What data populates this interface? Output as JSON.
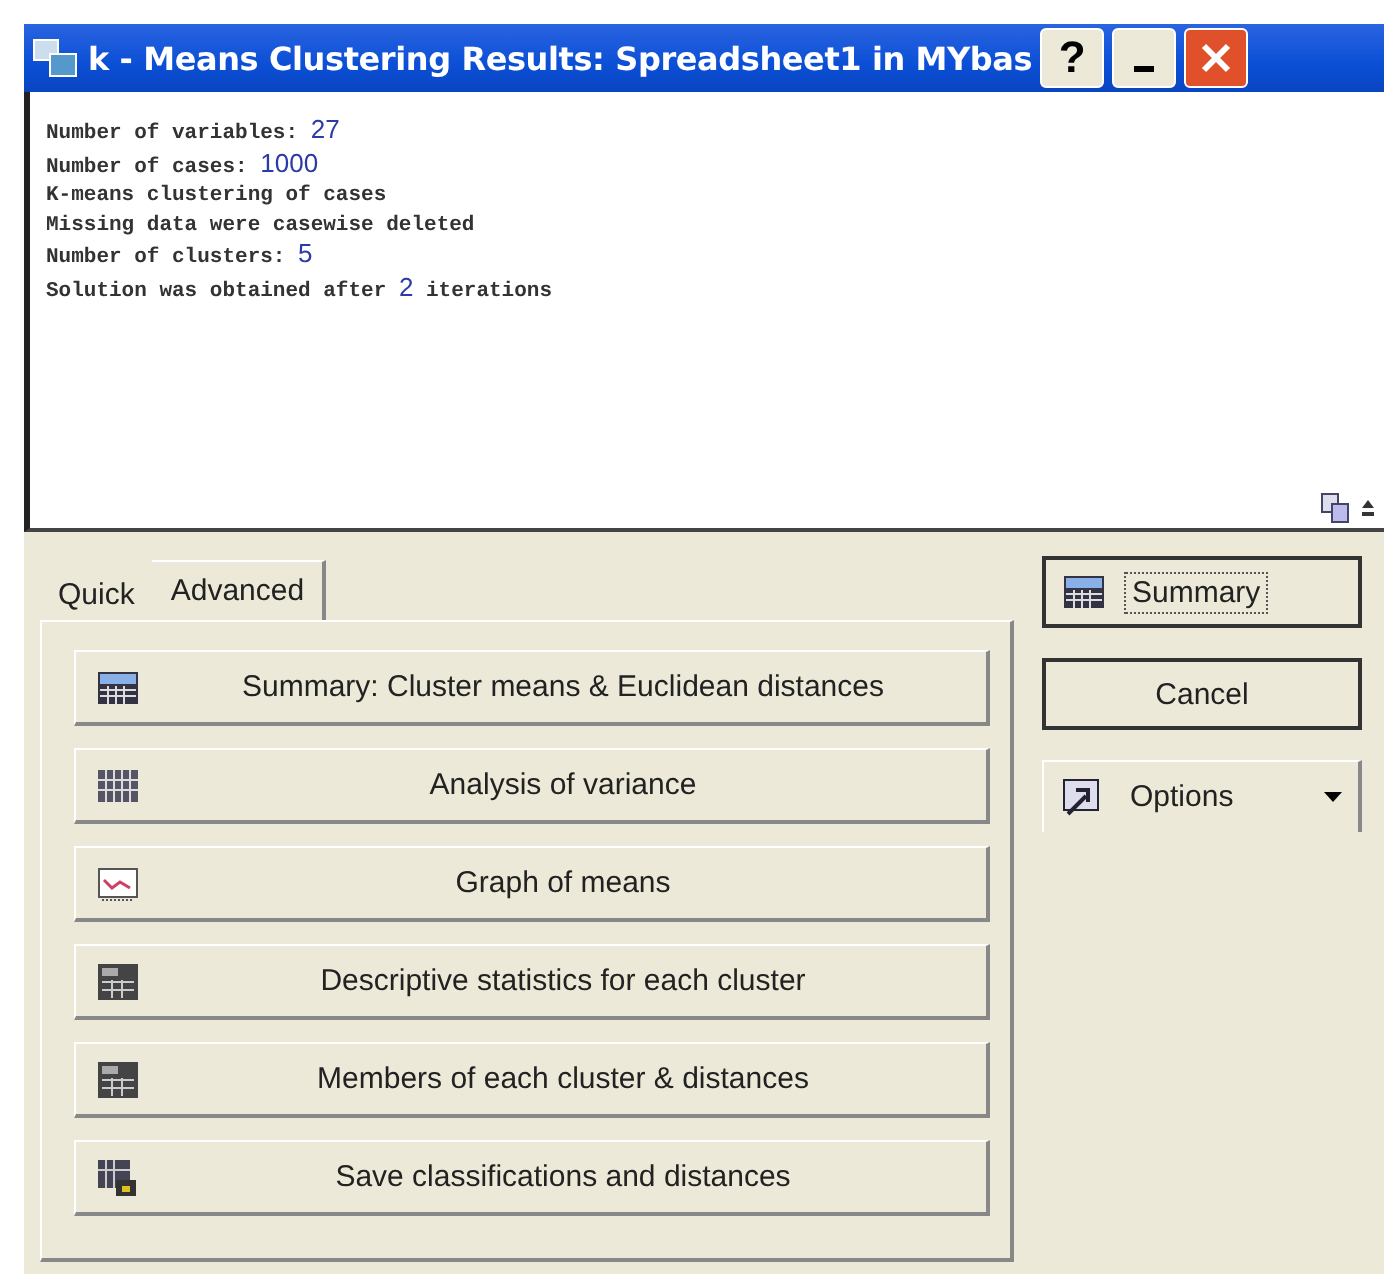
{
  "window": {
    "title": "k - Means Clustering Results: Spreadsheet1 in MYbas",
    "controls": [
      {
        "kind": "help",
        "label": "?"
      },
      {
        "kind": "minimize"
      },
      {
        "kind": "close"
      }
    ]
  },
  "output": {
    "lines": [
      {
        "label": "Number of variables:",
        "value": "27"
      },
      {
        "label": "Number of cases:",
        "value": "1000"
      },
      {
        "label": "K-means clustering of cases"
      },
      {
        "label": "Missing data were casewise deleted"
      },
      {
        "label": "Number of clusters:",
        "value": "5"
      },
      {
        "label": "Solution was obtained after",
        "value": "2",
        "suffix": "iterations"
      }
    ]
  },
  "tabs": [
    {
      "label": "Quick",
      "selected": false
    },
    {
      "label": "Advanced",
      "selected": true
    }
  ],
  "actions": [
    {
      "label": "Summary: Cluster means & Euclidean distances",
      "kind": "table"
    },
    {
      "label": "Analysis of variance",
      "kind": "grid"
    },
    {
      "label": "Graph of means",
      "kind": "graph"
    },
    {
      "label": "Descriptive statistics for each cluster",
      "kind": "sheet"
    },
    {
      "label": "Members of each cluster & distances",
      "kind": "sheet"
    },
    {
      "label": "Save classifications and distances",
      "kind": "save"
    }
  ],
  "side_buttons": [
    {
      "label": "Summary",
      "kind": "table",
      "focused": true
    },
    {
      "label": "Cancel",
      "kind": "plain"
    },
    {
      "label": "Options",
      "kind": "options",
      "dropdown": true
    }
  ]
}
